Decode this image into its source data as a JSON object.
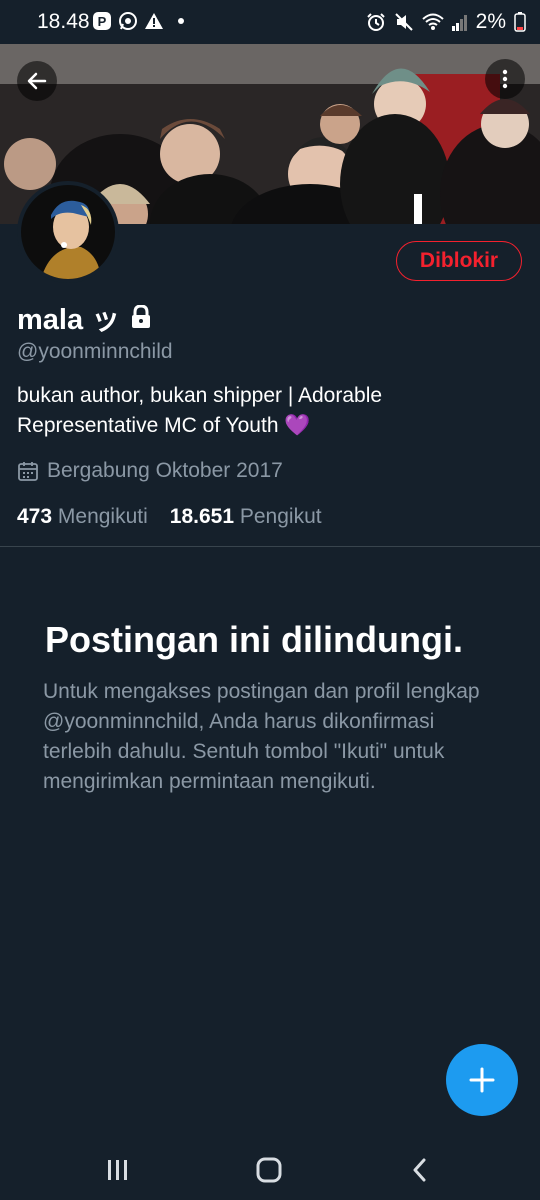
{
  "status_bar": {
    "time": "18.48",
    "battery": "2%"
  },
  "profile": {
    "name": "mala ッ",
    "handle": "@yoonminnchild",
    "bio": "bukan author, bukan shipper | Adorable Representative MC of Youth 💜",
    "joined": "Bergabung Oktober 2017",
    "following_count": "473",
    "following_label": "Mengikuti",
    "followers_count": "18.651",
    "followers_label": "Pengikut",
    "blocked_label": "Diblokir"
  },
  "protected": {
    "title": "Postingan ini dilindungi.",
    "message": "Untuk mengakses postingan dan profil lengkap @yoonminnchild, Anda harus dikonfirmasi terlebih dahulu. Sentuh tombol \"Ikuti\" untuk mengirimkan permintaan mengikuti."
  },
  "colors": {
    "background": "#15202b",
    "accent": "#1d9bf0",
    "blocked": "#f4212e",
    "muted": "#8b98a5"
  }
}
